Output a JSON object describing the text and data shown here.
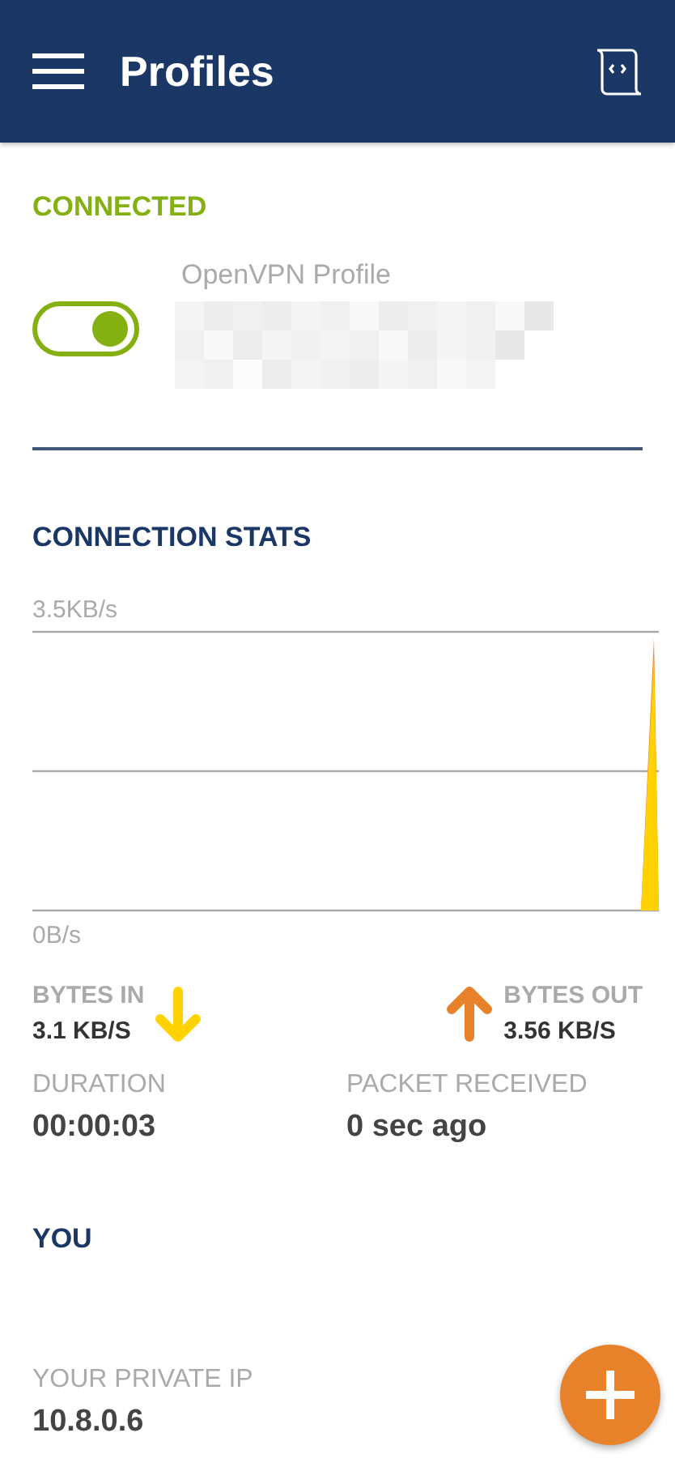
{
  "app_bar": {
    "title": "Profiles"
  },
  "status": {
    "label": "CONNECTED"
  },
  "profile": {
    "label": "OpenVPN Profile",
    "on": true,
    "name_redacted": true
  },
  "stats": {
    "title": "CONNECTION STATS",
    "graph": {
      "top_label": "3.5KB/s",
      "bottom_label": "0B/s"
    },
    "bytes_in": {
      "label": "BYTES IN",
      "value": "3.1 KB/S"
    },
    "bytes_out": {
      "label": "BYTES OUT",
      "value": "3.56 KB/S"
    },
    "duration": {
      "label": "DURATION",
      "value": "00:00:03"
    },
    "packet_received": {
      "label": "PACKET RECEIVED",
      "value": "0 sec ago"
    }
  },
  "you": {
    "title": "YOU",
    "private_ip": {
      "label": "YOUR PRIVATE IP",
      "value": "10.8.0.6"
    }
  }
}
